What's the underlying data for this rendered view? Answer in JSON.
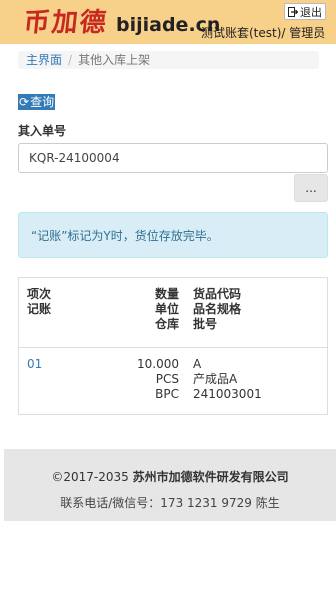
{
  "header": {
    "logo_text": "币加德",
    "site": "bijiade.cn",
    "user_info": "测试账套(test)/ 管理员",
    "logout_label": "退出"
  },
  "breadcrumb": {
    "home": "主界面",
    "current": "其他入库上架"
  },
  "query_button": "查询",
  "form": {
    "label": "其入单号",
    "order_value": "KQR-24100004",
    "more_button": "..."
  },
  "alert": "“记账”标记为Y时，货位存放完毕。",
  "table": {
    "headers": {
      "col1": [
        "项次",
        "记账"
      ],
      "col2": [
        "数量",
        "单位",
        "仓库"
      ],
      "col3": [
        "货品代码",
        "品名规格",
        "批号"
      ]
    },
    "rows": [
      {
        "item_no": "01",
        "qty": "10.000",
        "unit": "PCS",
        "warehouse": "BPC",
        "code": "A",
        "name": "产成品A",
        "batch": "241003001"
      }
    ]
  },
  "footer": {
    "copyright": "©2017-2035",
    "company": "苏州市加德软件研发有限公司",
    "contact": "联系电话/微信号：173 1231 9729 陈生"
  },
  "colors": {
    "header_bg": "#f7d08a",
    "logo_red": "#c7281f",
    "primary": "#337ab7",
    "alert_bg": "#d9edf7",
    "alert_text": "#31708f",
    "footer_bg": "#e6e6e6"
  }
}
